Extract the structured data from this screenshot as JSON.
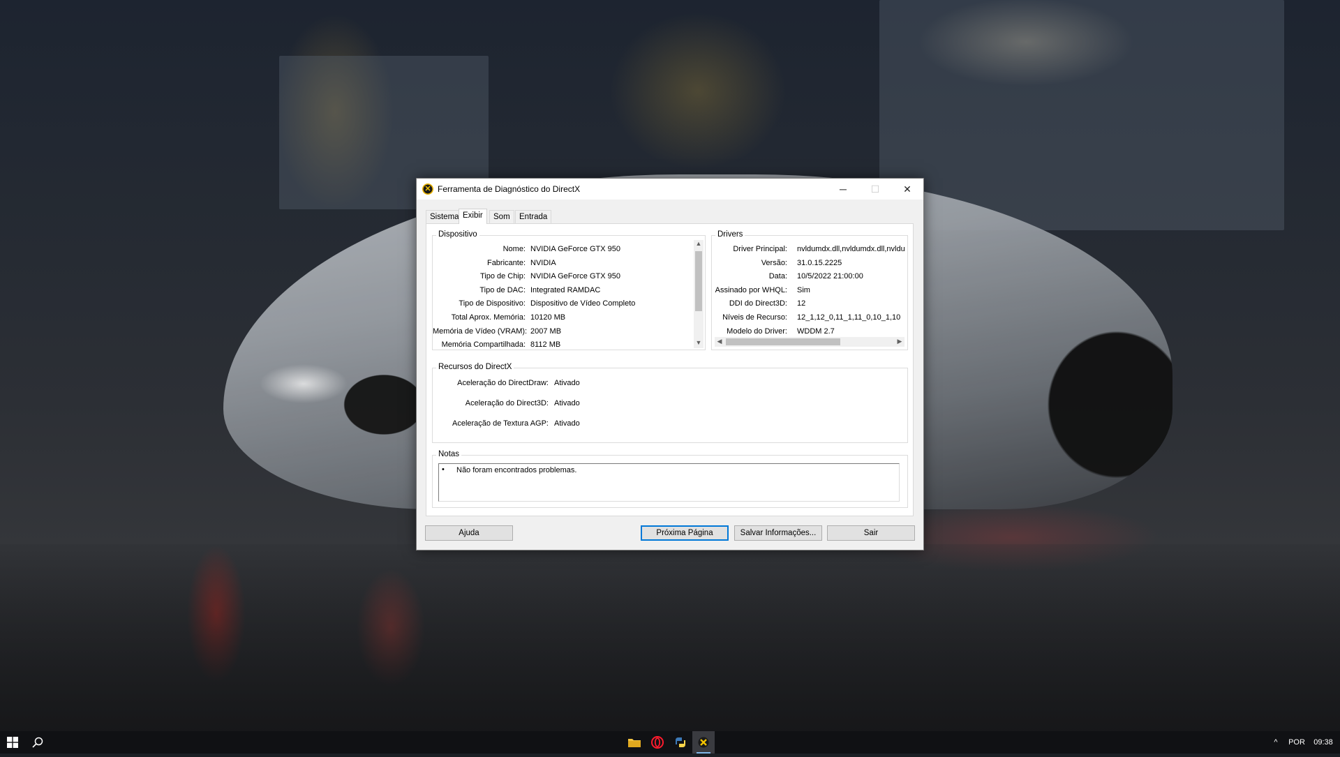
{
  "dialog": {
    "title": "Ferramenta de Diagnóstico do DirectX",
    "window_controls": {
      "minimize": "─",
      "maximize": "☐",
      "close": "✕"
    },
    "tabs": [
      {
        "label": "Sistema"
      },
      {
        "label": "Exibir"
      },
      {
        "label": "Som"
      },
      {
        "label": "Entrada"
      }
    ],
    "active_tab": "Exibir",
    "device": {
      "label": "Dispositivo",
      "rows": [
        {
          "key": "Nome:",
          "value": "NVIDIA GeForce GTX 950"
        },
        {
          "key": "Fabricante:",
          "value": "NVIDIA"
        },
        {
          "key": "Tipo de Chip:",
          "value": "NVIDIA GeForce GTX 950"
        },
        {
          "key": "Tipo de DAC:",
          "value": "Integrated RAMDAC"
        },
        {
          "key": "Tipo de Dispositivo:",
          "value": "Dispositivo de Vídeo Completo"
        },
        {
          "key": "Total Aprox. Memória:",
          "value": "10120 MB"
        },
        {
          "key": "Memória de Vídeo (VRAM):",
          "value": "2007 MB"
        },
        {
          "key": "Memória Compartilhada:",
          "value": "8112 MB"
        }
      ]
    },
    "drivers": {
      "label": "Drivers",
      "rows": [
        {
          "key": "Driver Principal:",
          "value": "nvldumdx.dll,nvldumdx.dll,nvldu"
        },
        {
          "key": "Versão:",
          "value": "31.0.15.2225"
        },
        {
          "key": "Data:",
          "value": "10/5/2022 21:00:00"
        },
        {
          "key": "Assinado por WHQL:",
          "value": "Sim"
        },
        {
          "key": "DDI do Direct3D:",
          "value": "12"
        },
        {
          "key": "Níveis de Recurso:",
          "value": "12_1,12_0,11_1,11_0,10_1,10"
        },
        {
          "key": "Modelo do Driver:",
          "value": "WDDM 2.7"
        }
      ]
    },
    "directx_features": {
      "label": "Recursos do DirectX",
      "rows": [
        {
          "key": "Aceleração do DirectDraw:",
          "value": "Ativado"
        },
        {
          "key": "Aceleração do Direct3D:",
          "value": "Ativado"
        },
        {
          "key": "Aceleração de Textura AGP:",
          "value": "Ativado"
        }
      ]
    },
    "notes": {
      "label": "Notas",
      "bullet": "•",
      "text": "Não foram encontrados problemas."
    },
    "buttons": {
      "help": "Ajuda",
      "next_page": "Próxima Página",
      "save_info": "Salvar Informações...",
      "exit": "Sair"
    }
  },
  "taskbar": {
    "language": "POR",
    "clock": "09:38",
    "tray_chevron": "^",
    "pinned": [
      {
        "icon": "file-explorer-icon"
      },
      {
        "icon": "opera-icon"
      },
      {
        "icon": "python-icon"
      },
      {
        "icon": "directx-icon"
      }
    ]
  }
}
